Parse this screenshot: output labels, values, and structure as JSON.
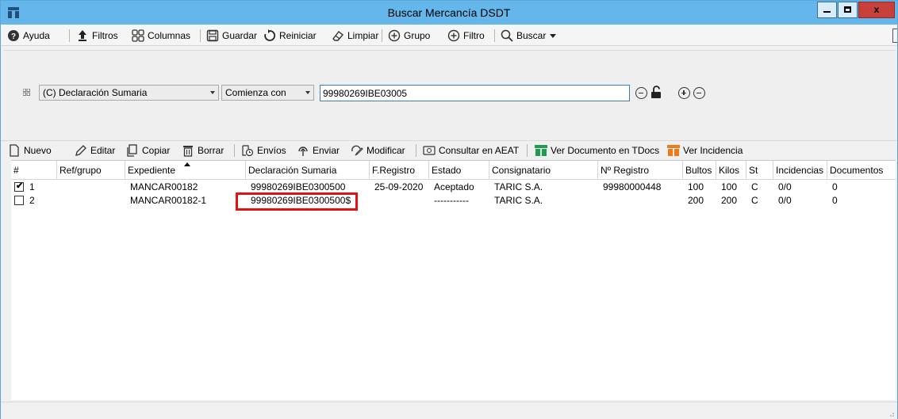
{
  "window": {
    "title": "Buscar Mercancía DSDT",
    "minimize_label": "",
    "close_label": "x"
  },
  "toolbar": {
    "ayuda": "Ayuda",
    "filtros": "Filtros",
    "columnas": "Columnas",
    "guardar": "Guardar",
    "reiniciar": "Reiniciar",
    "limpiar": "Limpiar",
    "grupo": "Grupo",
    "filtro": "Filtro",
    "buscar": "Buscar"
  },
  "filter": {
    "field": "(C) Declaración Sumaria",
    "operator": "Comienza con",
    "value": "99980269IBE03005"
  },
  "actions": {
    "nuevo": "Nuevo",
    "editar": "Editar",
    "copiar": "Copiar",
    "borrar": "Borrar",
    "envios": "Envíos",
    "enviar": "Enviar",
    "modificar": "Modificar",
    "consultar": "Consultar en AEAT",
    "ver_documento": "Ver Documento en TDocs",
    "ver_incidencia": "Ver Incidencia"
  },
  "grid": {
    "columns": [
      "#",
      "Ref/grupo",
      "Expediente",
      "Declaración Sumaria",
      "F.Registro",
      "Estado",
      "Consignatario",
      "Nº Registro",
      "Bultos",
      "Kilos",
      "St",
      "Incidencias",
      "Documentos"
    ],
    "rows": [
      {
        "checked": true,
        "num": "1",
        "ref": "",
        "expediente": "MANCAR00182",
        "declaracion": "99980269IBE0300500",
        "fregistro": "25-09-2020",
        "estado": "Aceptado",
        "consignatario": "TARIC S.A.",
        "nregistro": "99980000448",
        "bultos": "100",
        "kilos": "100",
        "st": "C",
        "incidencias": "0/0",
        "documentos": "0"
      },
      {
        "checked": false,
        "num": "2",
        "ref": "",
        "expediente": "MANCAR00182-1",
        "declaracion": "99980269IBE0300500$",
        "fregistro": "",
        "estado": "-----------",
        "consignatario": "TARIC S.A.",
        "nregistro": "",
        "bultos": "200",
        "kilos": "200",
        "st": "C",
        "incidencias": "0/0",
        "documentos": "0"
      }
    ]
  },
  "colors": {
    "titlebar": "#65b6ea",
    "highlight": "#e21212",
    "tdocs_green": "#1e9e4c",
    "incidencia_orange": "#f07a1a"
  }
}
